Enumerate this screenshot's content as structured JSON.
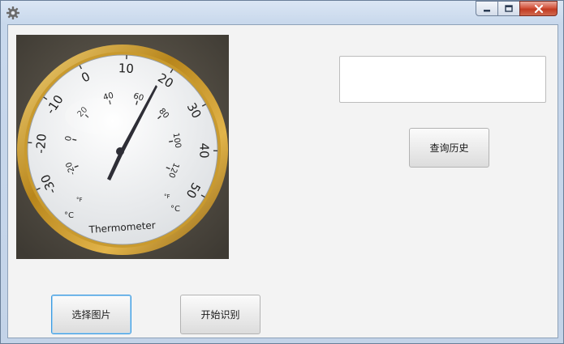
{
  "window": {
    "app_icon": "gear-icon",
    "controls": {
      "minimize": "minimize-icon",
      "maximize": "maximize-icon",
      "close": "close-icon"
    }
  },
  "image_view": {
    "dial": {
      "celsius_ticks": [
        "-30",
        "-20",
        "-10",
        "0",
        "10",
        "20",
        "30",
        "40",
        "50"
      ],
      "fahrenheit_ticks": [
        "-20",
        "0",
        "20",
        "40",
        "60",
        "80",
        "100",
        "120"
      ],
      "celsius_unit": "°C",
      "fahrenheit_unit": "°F",
      "brand_text": "Thermometer"
    }
  },
  "result_field": {
    "value": ""
  },
  "buttons": {
    "history": "查询历史",
    "select_image": "选择图片",
    "start_recognition": "开始识别"
  }
}
